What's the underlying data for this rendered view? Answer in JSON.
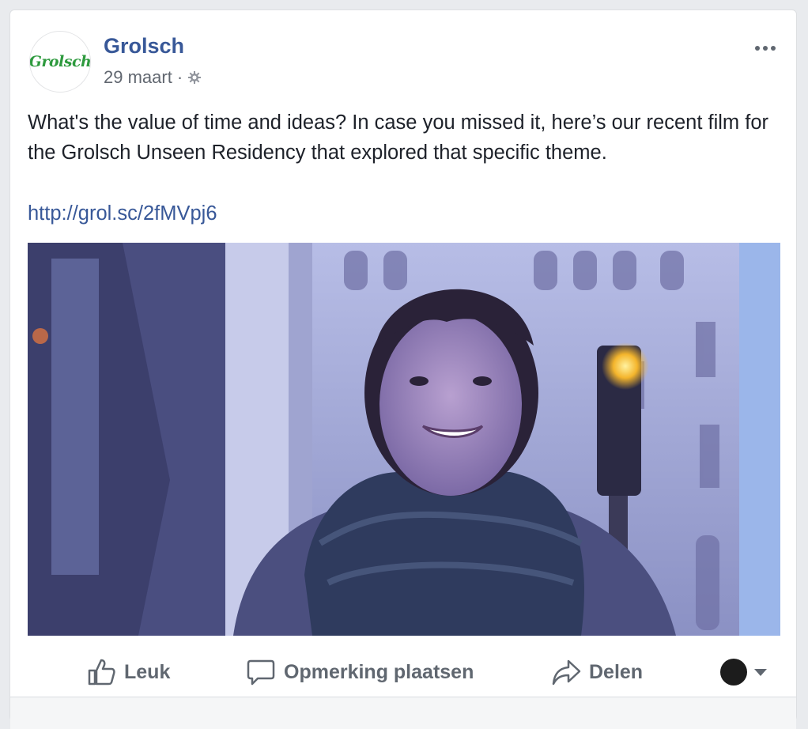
{
  "post": {
    "page_name": "Grolsch",
    "logo_text": "Grolsch",
    "date": "29 maart",
    "separator": "·",
    "audience_icon": "globe-icon",
    "more_icon": "more-options-icon",
    "text": "What's the value of time and ideas? In case you missed it, here’s our recent film for the Grolsch Unseen Residency that explored that specific theme.",
    "link": "http://grol.sc/2fMVpj6",
    "media": {
      "type": "video-thumbnail"
    }
  },
  "actions": {
    "like_label": "Leuk",
    "comment_label": "Opmerking plaatsen",
    "share_label": "Delen",
    "like_icon": "thumbs-up-icon",
    "comment_icon": "speech-bubble-icon",
    "share_icon": "share-arrow-icon",
    "selector_icon": "chevron-down-icon"
  },
  "colors": {
    "brand_blue": "#385898",
    "logo_green": "#2e9a3e",
    "muted_text": "#606770"
  }
}
